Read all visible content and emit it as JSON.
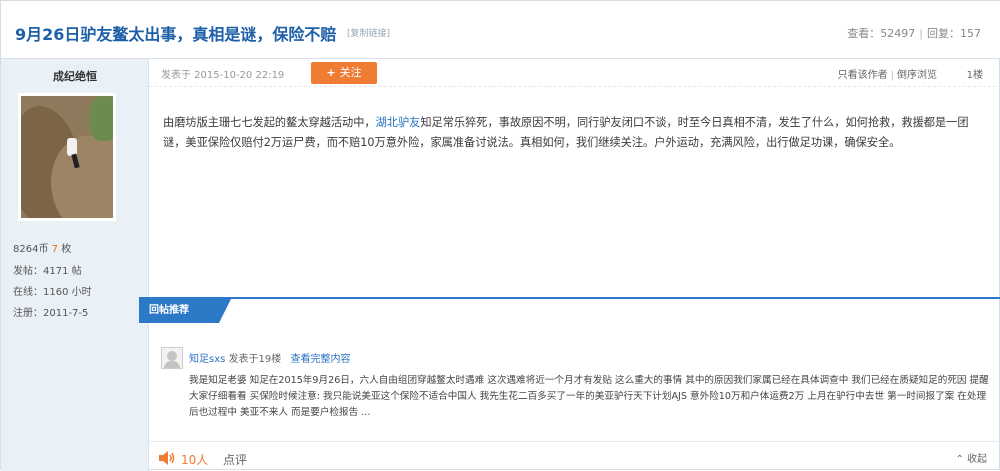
{
  "header": {
    "title": "9月26日驴友鳌太出事，真相是谜，保险不赔",
    "tag": "[复制链接]",
    "views_label": "查看：",
    "views": "52497",
    "replies_label": "回复：",
    "replies": "157"
  },
  "author": {
    "name": "成纪绝恒",
    "coins_label": "8264币",
    "coins_extra": "7",
    "coins_unit": "枚",
    "posts": "发帖：4171 帖",
    "online": "在线：1160 小时",
    "registered": "注册：2011-7-5"
  },
  "post": {
    "date": "发表于 2015-10-20 22:19",
    "follow_label": "关注",
    "only_author": "只看该作者",
    "reverse_order": "倒序浏览",
    "floor": "1楼",
    "body_pre": "由磨坊版主珊七七发起的鳌太穿越活动中，",
    "body_link": "湖北驴友",
    "body_post": "知足常乐猝死，事故原因不明，同行驴友闭口不谈，时至今日真相不清，发生了什么，如何抢救，救援都是一团谜，美亚保险仅赔付2万运尸费，而不赔10万意外险，家属准备讨说法。真相如何，我们继续关注。户外运动，充满风险，出行做足功课，确保安全。"
  },
  "recommend": {
    "tab": "回帖推荐",
    "user": "知足sxs",
    "meta": "发表于19楼",
    "view_all": "查看完整内容",
    "text": "我是知足老婆 知足在2015年9月26日，六人自由组团穿越鳌太时遇难 这次遇难将近一个月才有发贴 这么重大的事情 其中的原因我们家属已经在具体调查中 我们已经在质疑知足的死因 提醒大家仔细看看 买保险时候注意: 我只能说美亚这个保险不适合中国人 我先生花二百多买了一年的美亚驴行天下计划AJS 意外险10万和户体运费2万 上月在驴行中去世 第一时间报了案 在处理后也过程中 美亚不来人 而是要户检报告 ..."
  },
  "footer": {
    "like_count": "10人",
    "comment_label": "点评",
    "collapse_label": "收起"
  }
}
